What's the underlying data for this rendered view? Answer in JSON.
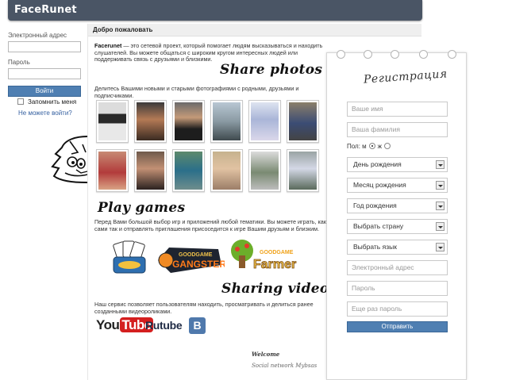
{
  "header": {
    "brand": "FaceRunet"
  },
  "login": {
    "email_label": "Электронный адрес",
    "password_label": "Пароль",
    "login_button": "Войти",
    "remember_label": "Запомнить меня",
    "forgot_link": "Не можете войти?"
  },
  "main": {
    "welcome": "Добро пожаловать",
    "intro_brand": "Facerunet",
    "intro_text": " — это сетевой проект, который помогает людям высказываться и находить слушателей. Вы можете общаться с широким кругом интересных людей или поддерживать связь с друзьями и близкими.",
    "share_photos_heading": "Share photos",
    "share_photos_text": "Делитесь Вашими новыми и старыми фотографиями с родными, друзьями и подписчиками.",
    "play_games_heading": "Play games",
    "play_games_text": "Перед Вами большой выбор игр и приложений любой тематики. Вы можете играть, как сами так и отправлять приглашения присоседится к игре Вашим друзьям и близким.",
    "games": [
      "GOODGAME GANGSTER",
      "GOODGAME Farmer"
    ],
    "sharing_videos_heading": "Sharing videos",
    "sharing_videos_text": "Наш сервис позволяет пользователям находить, просматривать и делиться ранее созданными видеороликами.",
    "video_services": {
      "youtube_you": "You",
      "youtube_tube": "Tube",
      "rutube": "Rutube",
      "vk": "B"
    },
    "signature": {
      "line1": "Welcome",
      "line2": "Social network Mybsas"
    }
  },
  "registration": {
    "title": "Регистрация",
    "first_name_placeholder": "Ваше имя",
    "last_name_placeholder": "Ваша фамилия",
    "gender_label": "Пол: м",
    "gender_female": "ж",
    "gender_selected": "м",
    "birth_day": "День рождения",
    "birth_month": "Месяц рождения",
    "birth_year": "Год рождения",
    "country": "Выбрать страну",
    "language": "Выбрать язык",
    "email_placeholder": "Электронный адрес",
    "password_placeholder": "Пароль",
    "password_repeat_placeholder": "Еще раз пароль",
    "submit": "Отправить"
  },
  "colors": {
    "topbar": "#4a5565",
    "button": "#4f7fb2",
    "youtube_red": "#d41f1f",
    "vk_blue": "#4f79ac"
  }
}
